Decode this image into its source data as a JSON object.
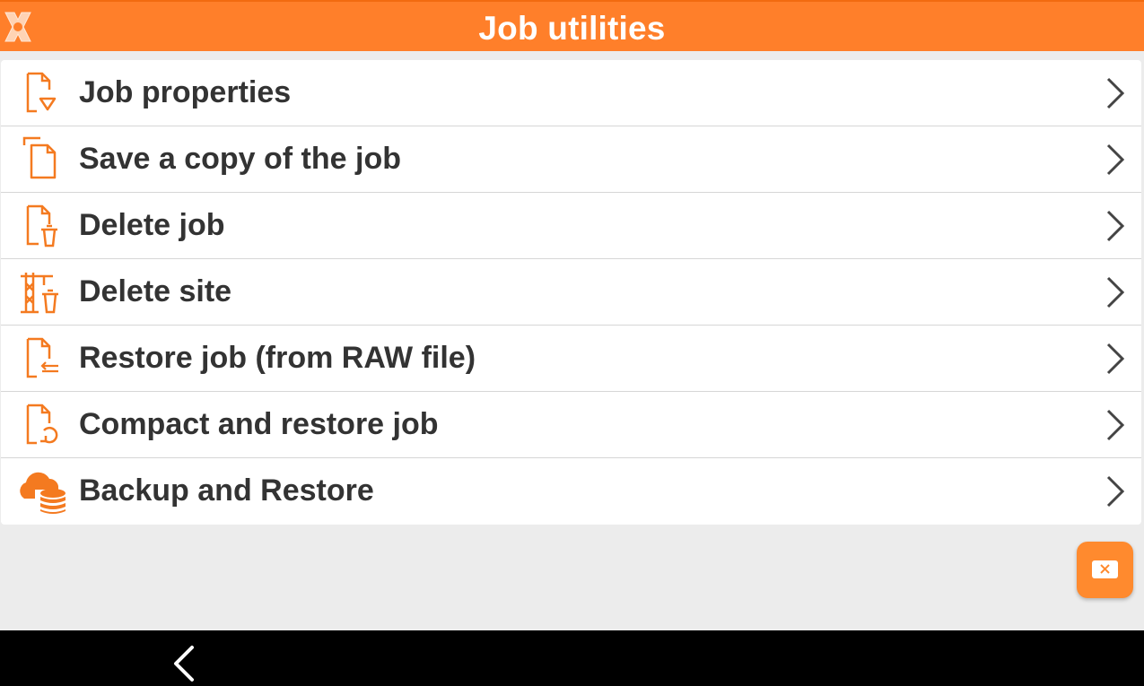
{
  "header": {
    "title": "Job utilities",
    "logo_icon": "app-x-logo-icon"
  },
  "menu": {
    "items": [
      {
        "label": "Job properties",
        "icon": "document-properties-icon"
      },
      {
        "label": "Save a copy of the job",
        "icon": "copy-document-icon"
      },
      {
        "label": "Delete job",
        "icon": "document-delete-icon"
      },
      {
        "label": "Delete site",
        "icon": "site-crane-delete-icon"
      },
      {
        "label": "Restore job (from RAW file)",
        "icon": "document-restore-icon"
      },
      {
        "label": "Compact and restore job",
        "icon": "document-compact-restore-icon"
      },
      {
        "label": "Backup and Restore",
        "icon": "cloud-database-icon"
      }
    ]
  },
  "fab": {
    "icon": "keyboard-close-icon"
  },
  "navbar": {
    "back_icon": "back-chevron-icon"
  },
  "colors": {
    "accent": "#ff7f2a",
    "text": "#333333",
    "background": "#ececec"
  }
}
